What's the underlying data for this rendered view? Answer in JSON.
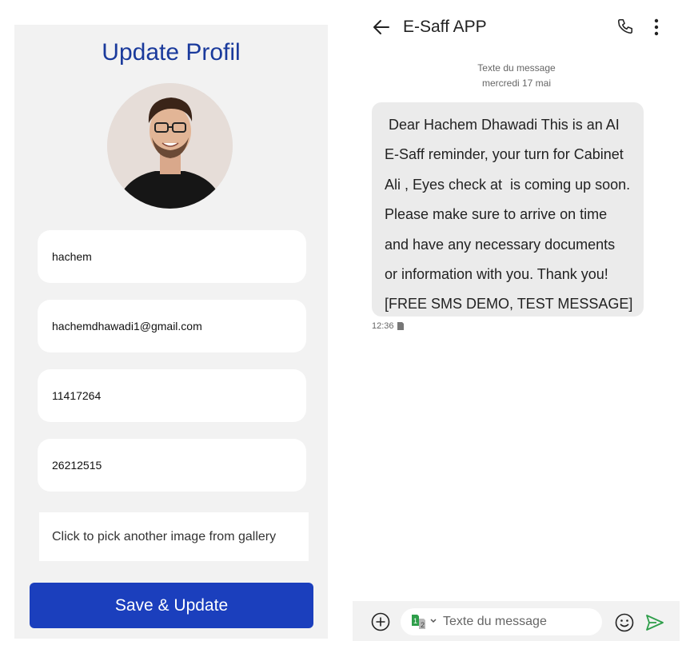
{
  "profile": {
    "title": "Update Profil",
    "fields": [
      {
        "value": "hachem"
      },
      {
        "value": "hachemdhawadi1@gmail.com"
      },
      {
        "value": "11417264"
      },
      {
        "value": "26212515"
      }
    ],
    "pick_image_label": "Click to pick another image from gallery",
    "save_button_label": "Save & Update"
  },
  "sms": {
    "app_title": "E-Saff APP",
    "meta_label": "Texte du message",
    "date": "mercredi 17 mai",
    "message_lines": [
      " Dear Hachem Dhawadi This is an AI",
      "E-Saff reminder, your turn for Cabinet",
      "Ali , Eyes check at  is coming up soon.",
      "Please make sure to arrive on time",
      "and have any necessary documents",
      "or information with you. Thank you!",
      "[FREE SMS DEMO, TEST MESSAGE]"
    ],
    "time": "12:36",
    "compose_placeholder": "Texte du message"
  },
  "icons": {
    "back": "arrow-left-icon",
    "call": "phone-icon",
    "more": "more-vertical-icon",
    "add": "plus-circle-icon",
    "sim": "sim-card-icon",
    "emoji": "emoji-icon",
    "send": "send-icon"
  },
  "colors": {
    "title_blue": "#1a3a9c",
    "button_blue": "#1b3fbd",
    "panel_gray": "#f2f2f2",
    "bubble_gray": "#ebebeb",
    "sim_green": "#2e9e4a",
    "send_green": "#2e9e4a"
  }
}
